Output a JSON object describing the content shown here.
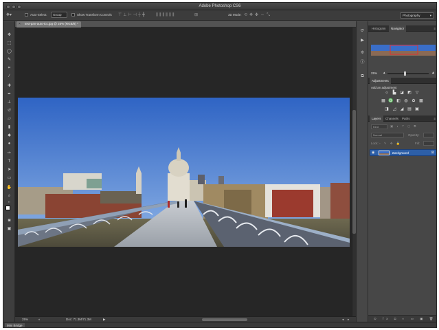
{
  "titlebar": {
    "title": "Adobe Photoshop CS6"
  },
  "options_bar": {
    "auto_select_label": "Auto-Select:",
    "auto_select_value": "Group",
    "show_transform_label": "Show Transform Controls",
    "mode_label": "3D Mode:",
    "workspace": "Photography"
  },
  "document": {
    "tab_title": "test-pan-auto-tcc.jpg @ 25% (RGB/8) *"
  },
  "statusbar": {
    "zoom": "25%",
    "doc_info": "Doc: 71.3M/71.3M"
  },
  "minibridge": {
    "label": "Mini Bridge"
  },
  "navigator": {
    "tabs": [
      "Histogram",
      "Navigator"
    ],
    "zoom": "25%"
  },
  "adjustments": {
    "tab": "Adjustments",
    "subtitle": "Add an adjustment"
  },
  "layers": {
    "tabs": [
      "Layers",
      "Channels",
      "Paths"
    ],
    "filter_label": "Kind",
    "blend_mode": "Normal",
    "opacity_label": "Opacity:",
    "lock_label": "Lock:",
    "fill_label": "Fill:",
    "layer_name": "Background"
  },
  "colors": {
    "accent_selection": "#2d5fa8",
    "navigator_view_box": "#e03030"
  }
}
